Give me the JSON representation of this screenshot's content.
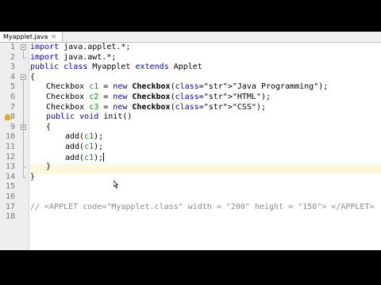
{
  "tab": {
    "label": "Myapplet.java"
  },
  "lines": [
    {
      "num": "1",
      "text": "import java.applet.*;"
    },
    {
      "num": "2",
      "text": "import java.awt.*;"
    },
    {
      "num": "3",
      "text": "public class Myapplet extends Applet"
    },
    {
      "num": "4",
      "text": "{"
    },
    {
      "num": "5",
      "text": "Checkbox c1 = new Checkbox(\"Java Programming\");"
    },
    {
      "num": "6",
      "text": "Checkbox c2 = new Checkbox(\"HTML\");"
    },
    {
      "num": "7",
      "text": "Checkbox c3 = new Checkbox(\"CSS\");"
    },
    {
      "num": "8",
      "text": "public void init()"
    },
    {
      "num": "9",
      "text": "{"
    },
    {
      "num": "10",
      "text": "add(c1);"
    },
    {
      "num": "11",
      "text": "add(c1);"
    },
    {
      "num": "12",
      "text": "add(c1);"
    },
    {
      "num": "13",
      "text": "}"
    },
    {
      "num": "14",
      "text": "}"
    },
    {
      "num": "15",
      "text": ""
    },
    {
      "num": "16",
      "text": ""
    },
    {
      "num": "17",
      "text": "// <APPLET code=\"Myapplet.class\" width = \"200\" height = \"150\"> </APPLET>"
    },
    {
      "num": "18",
      "text": ""
    }
  ],
  "colors": {
    "keyword": "#0000e6",
    "field": "#009900",
    "string": "#ce7b00",
    "comment": "#8a8a8a",
    "current_line": "#fcf8dc",
    "gutter": "#eeeeee"
  },
  "icons": {
    "fold": "fold-collapse-icon",
    "hint": "lightbulb-hint-icon",
    "cursor": "mouse-pointer-icon"
  }
}
